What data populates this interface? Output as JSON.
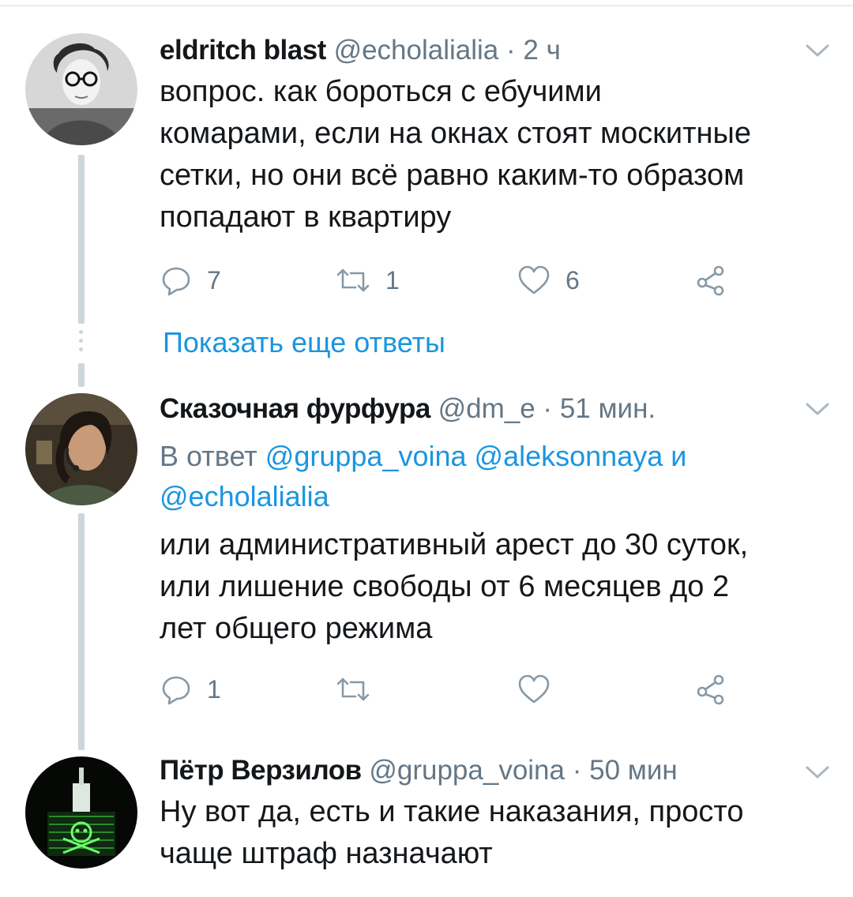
{
  "show_more_replies": "Показать еще ответы",
  "tweets": [
    {
      "name": "eldritch blast",
      "handle": "@echolalialia",
      "separator": "·",
      "time": "2 ч",
      "text_lines": [
        "вопрос. как бороться с ебучими",
        "комарами, если на окнах стоят москитные",
        "сетки, но они всё равно каким-то образом",
        "попадают в квартиру"
      ],
      "reply_count": "7",
      "retweet_count": "1",
      "like_count": "6"
    },
    {
      "name": "Сказочная фурфура",
      "handle": "@dm_e",
      "separator": "·",
      "time": "51 мин.",
      "reply_to_prefix": "В ответ",
      "reply_to_mentions": [
        "@gruppa_voina",
        "@aleksonnaya"
      ],
      "reply_to_and": "и",
      "reply_to_last": "@echolalialia",
      "text_lines": [
        "или административный арест до 30 суток,",
        "или лишение свободы от 6 месяцев до 2",
        "лет общего режима"
      ],
      "reply_count": "1",
      "retweet_count": "",
      "like_count": ""
    },
    {
      "name": "Пётр Верзилов",
      "handle": "@gruppa_voina",
      "separator": "·",
      "time": "50 мин",
      "text_lines": [
        "Ну вот да, есть и такие наказания, просто",
        "чаще штраф назначают"
      ]
    }
  ],
  "icons": {
    "reply": "reply-icon",
    "retweet": "retweet-icon",
    "like": "heart-icon",
    "share": "share-icon",
    "caret": "chevron-down-icon"
  },
  "colors": {
    "link": "#1b95e0",
    "meta": "#657786",
    "thread_line": "#ccd6dd",
    "icon": "#8899a6"
  }
}
